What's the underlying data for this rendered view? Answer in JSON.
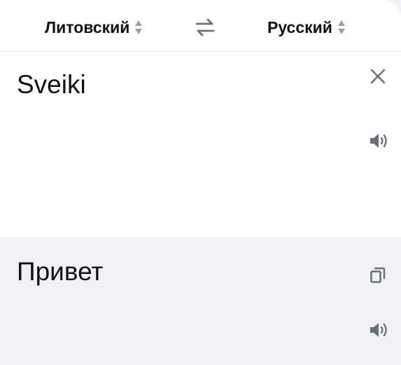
{
  "languages": {
    "source": "Литовский",
    "target": "Русский",
    "sort_icon": "sort-updown-icon",
    "swap_icon": "swap-arrows-icon"
  },
  "input": {
    "text": "Sveiki",
    "clear_icon": "close-icon",
    "speak_icon": "speaker-icon"
  },
  "output": {
    "text": "Привет",
    "copy_icon": "copy-icon",
    "speak_icon": "speaker-icon"
  },
  "colors": {
    "card": "#ffffff",
    "result_background": "#f0f1f5",
    "icon": "#6b6f7a",
    "text": "#111111"
  }
}
